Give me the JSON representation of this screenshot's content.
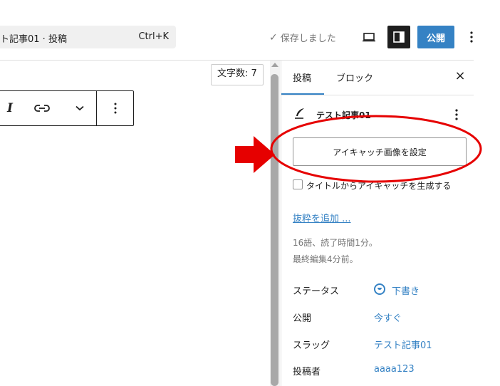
{
  "header": {
    "doc_title": "ト記事01 · 投稿",
    "shortcut": "Ctrl+K",
    "saved_check": "✓",
    "saved_text": "保存しました",
    "publish_label": "公開"
  },
  "editor": {
    "wordcount": "文字数: 7",
    "toolbar": {
      "italic": "I"
    }
  },
  "sidebar": {
    "tabs": [
      "投稿",
      "ブロック"
    ],
    "close": "×",
    "post_title": "テスト記事01",
    "featured_image_button": "アイキャッチ画像を設定",
    "generate_featured_label": "タイトルからアイキャッチを生成する",
    "excerpt_link": "抜粋を追加 ...",
    "stats_line1": "16語、読了時間1分。",
    "stats_line2": "最終編集4分前。",
    "rows": [
      {
        "label": "ステータス",
        "value": "下書き"
      },
      {
        "label": "公開",
        "value": "今すぐ"
      },
      {
        "label": "スラッグ",
        "value": "テスト記事01"
      },
      {
        "label": "投稿者",
        "value": "aaaa123"
      }
    ]
  },
  "colors": {
    "accent": "#3582c4",
    "annotation": "#e60000",
    "settings_active": "#1e1e1e"
  },
  "icons": {
    "preview": "desktop-preview-icon",
    "settings": "sidebar-toggle-icon",
    "options": "vertical-ellipsis-icon",
    "link": "link-icon",
    "chevron": "chevron-down-icon",
    "post": "feather-pen-icon",
    "status": "draft-status-icon"
  }
}
